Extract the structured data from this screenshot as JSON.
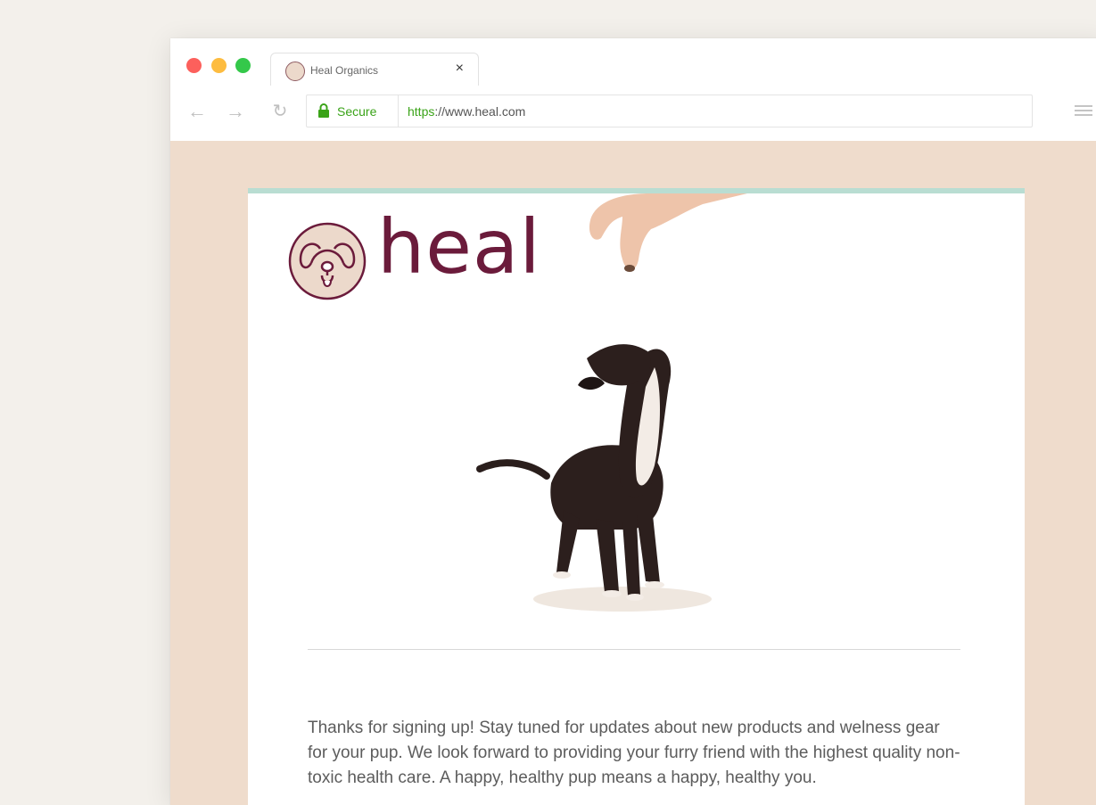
{
  "browser": {
    "tab": {
      "title": "Heal Organics",
      "close": "×"
    },
    "nav": {
      "back": "←",
      "forward": "→",
      "reload": "↻"
    },
    "address": {
      "secure_label": "Secure",
      "scheme": "https",
      "rest": "://www.heal.com"
    },
    "colors": {
      "secure_green": "#3aa318",
      "tab_red": "#fc605c",
      "tab_yellow": "#fdbc40",
      "tab_green": "#34c84a"
    }
  },
  "email": {
    "brand": "heal",
    "brand_color": "#6b1b3b",
    "accent_color": "#b9ddd2",
    "page_background": "#efdccc",
    "body_text": "Thanks for signing up! Stay tuned for updates about new products and welness gear for your pup. We look forward to providing your furry friend with the highest quality non-toxic health care. A happy, healthy pup means a happy, healthy you."
  }
}
